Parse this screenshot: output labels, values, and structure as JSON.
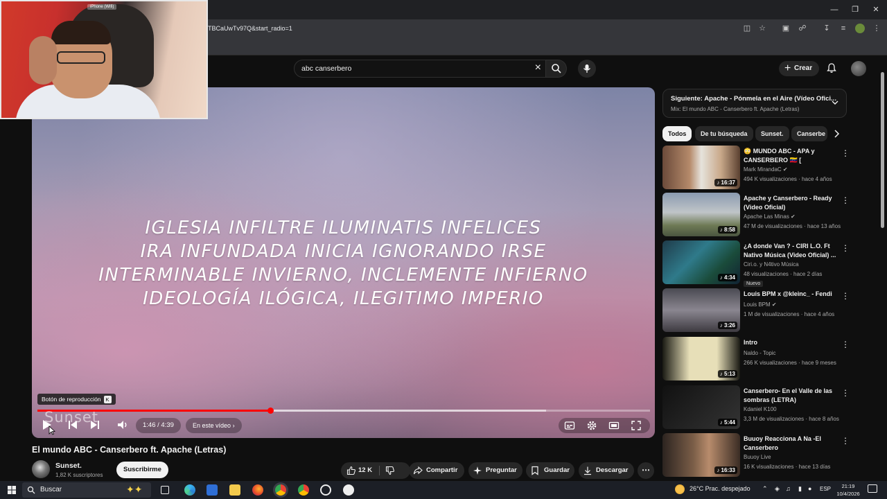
{
  "browser": {
    "url": "TBCaUwTv97Q&start_radio=1"
  },
  "webcam": {
    "tag": "iPhone (Wifi)"
  },
  "header": {
    "search_value": "abc canserbero",
    "create_label": "Crear"
  },
  "player": {
    "lyrics": [
      "IGLESIA INFILTRE ILUMINATIS INFELICES",
      "IRA INFUNDADA INICIA IGNORANDO IRSE",
      "INTERMINABLE INVIERNO, INCLEMENTE INFIERNO",
      "IDEOLOGÍA ILÓGICA, ILEGITIMO IMPERIO"
    ],
    "tooltip": "Botón de reproducción",
    "tooltip_key": "K",
    "watermark": "Sunset",
    "time": "1:46 / 4:39",
    "chapter_label": "En este vídeo",
    "progress_fraction": 0.38,
    "buffer_fraction": 0.83
  },
  "video": {
    "title": "El mundo ABC - Canserbero ft. Apache (Letras)",
    "channel": "Sunset.",
    "subscribers": "1,82 K suscriptores",
    "subscribe_label": "Suscribirme",
    "likes": "12 K",
    "share_label": "Compartir",
    "ask_label": "Preguntar",
    "save_label": "Guardar",
    "download_label": "Descargar"
  },
  "sidebar": {
    "upnext_title": "Siguiente: Apache - Pónmela en el Aire (Vídeo Ofici...",
    "upnext_sub": "Mix: El mundo ABC - Canserbero ft. Apache (Letras)",
    "chips": [
      "Todos",
      "De tu búsqueda",
      "Sunset.",
      "Canserbe"
    ],
    "recs": [
      {
        "title": "😳 MUNDO ABC - APA y CANSERBERO 🇻🇪 [ REACCIÓN...",
        "channel": "Mark MirandaC",
        "meta": "494 K visualizaciones · hace 4 años",
        "duration": "16:37",
        "verified": true,
        "badge": ""
      },
      {
        "title": "Apache y Canserbero - Ready (Video Oficial)",
        "channel": "Apache Las Minas",
        "meta": "47 M de visualizaciones · hace 13 años",
        "duration": "8:58",
        "verified": true,
        "badge": ""
      },
      {
        "title": "¿A donde Van ? - CIRI L.O. Ft Nativo Música (Video Oficial) ...",
        "channel": "Ciri.o. y N4tivo Música",
        "meta": "48 visualizaciones · hace 2 días",
        "duration": "4:34",
        "verified": false,
        "badge": "Nuevo"
      },
      {
        "title": "Louis BPM x @kleinc_ - Fendi",
        "channel": "Louis BPM",
        "meta": "1 M de visualizaciones · hace 4 años",
        "duration": "3:26",
        "verified": true,
        "badge": ""
      },
      {
        "title": "Intro",
        "channel": "Naldo - Topic",
        "meta": "266 K visualizaciones · hace 9 meses",
        "duration": "5:13",
        "verified": false,
        "badge": ""
      },
      {
        "title": "Canserbero- En el Valle de las sombras (LETRA)",
        "channel": "Kdaniel K100",
        "meta": "3,3 M de visualizaciones · hace 8 años",
        "duration": "5:44",
        "verified": false,
        "badge": ""
      },
      {
        "title": "Buuoy Reacciona A Na -El Canserbero",
        "channel": "Buuoy Live",
        "meta": "16 K visualizaciones · hace 13 días",
        "duration": "16:33",
        "verified": false,
        "badge": ""
      }
    ]
  },
  "taskbar": {
    "search_placeholder": "Buscar",
    "weather": "26°C  Prac. despejado",
    "lang": "ESP",
    "time": "21:19",
    "date": "10/4/2026"
  },
  "colors": {
    "accent": "#ff0000",
    "background": "#0f0f0f"
  }
}
